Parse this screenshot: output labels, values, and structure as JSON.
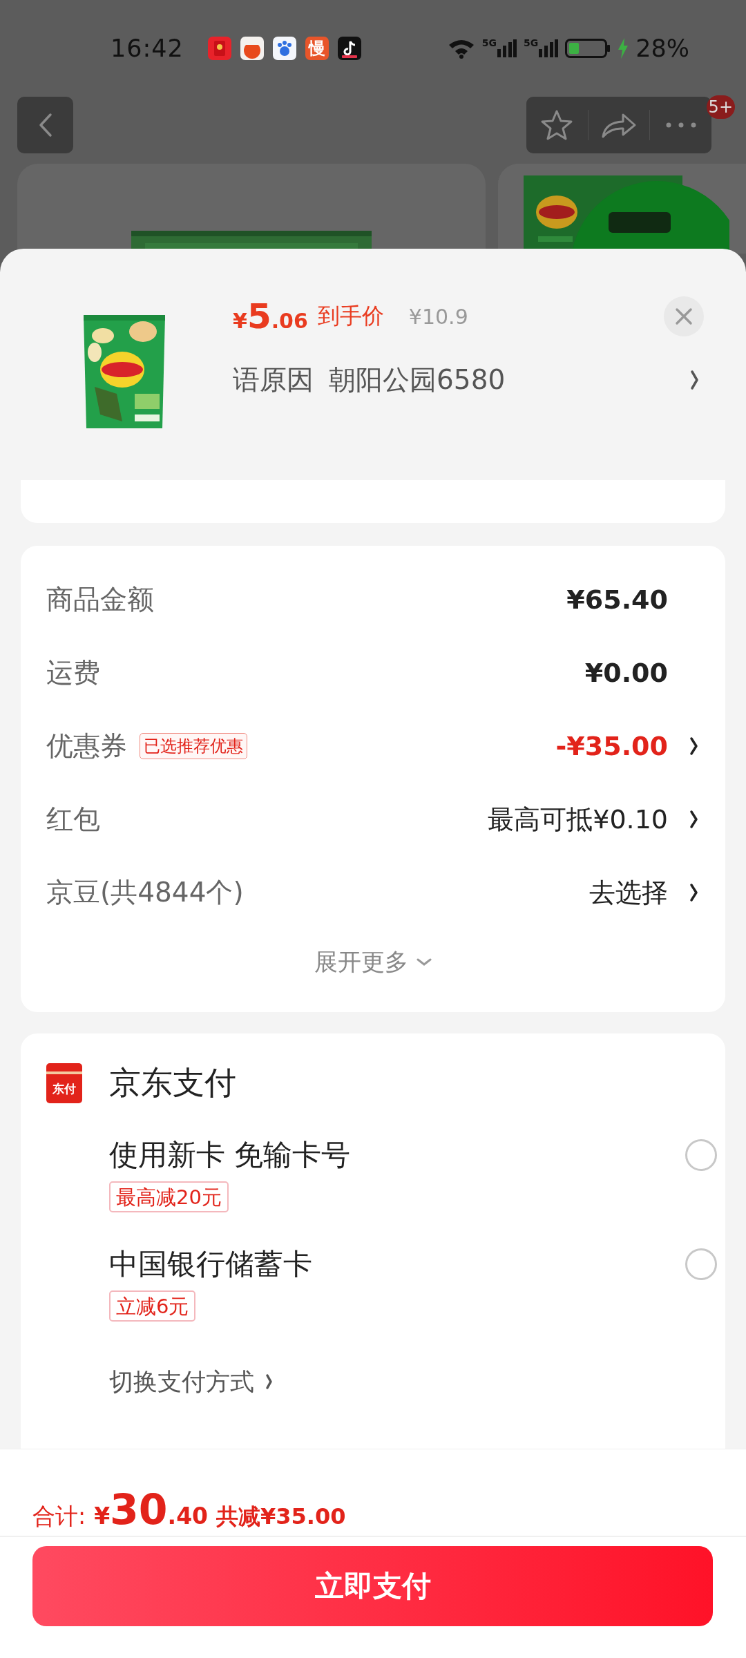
{
  "status_bar": {
    "time": "16:42",
    "notification_icons": [
      {
        "kind": "envelope"
      },
      {
        "kind": "tomato"
      },
      {
        "kind": "paw"
      },
      {
        "kind": "glyph",
        "text": "慢"
      },
      {
        "kind": "note"
      }
    ],
    "networks": [
      "5G",
      "5G"
    ],
    "charging": true,
    "battery": "28%"
  },
  "nav": {
    "badge": "5+"
  },
  "product": {
    "currency": "¥",
    "price_int": "5",
    "price_dec": ".06",
    "price_label": "到手价",
    "original_price": "¥10.9",
    "receiver": "语原因",
    "place": "朝阳公园6580"
  },
  "fees": [
    {
      "label": "商品金额",
      "value": "¥65.40",
      "kind": "plain"
    },
    {
      "label": "运费",
      "value": "¥0.00",
      "kind": "plain"
    },
    {
      "label": "优惠券",
      "tag": "已选推荐优惠",
      "value": "-¥35.00",
      "kind": "discount"
    },
    {
      "label": "红包",
      "value": "最高可抵¥0.10",
      "kind": "link"
    },
    {
      "label": "京豆(共4844个)",
      "value": "去选择",
      "kind": "link"
    }
  ],
  "expand": "展开更多",
  "payment": {
    "icon_text": "东付",
    "title": "京东支付",
    "options": [
      {
        "name": "使用新卡 免输卡号",
        "tag": "最高减20元",
        "selected": false
      },
      {
        "name": "中国银行储蓄卡",
        "tag": "立减6元",
        "selected": false
      }
    ],
    "switch": "切换支付方式"
  },
  "footer": {
    "total_label": "合计:",
    "currency": "¥",
    "total_int": "30",
    "total_dec": ".40",
    "saved": "共减¥35.00",
    "pay_button": "立即支付"
  }
}
